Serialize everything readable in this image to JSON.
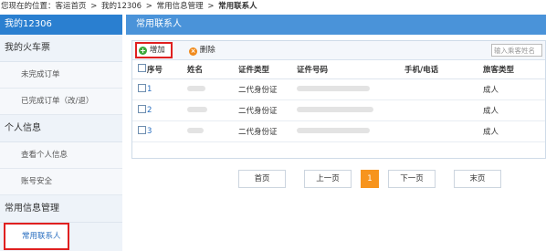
{
  "breadcrumb": {
    "prefix": "您现在的位置：客运首页",
    "sep": ">",
    "item1": "我的12306",
    "item2": "常用信息管理",
    "current": "常用联系人"
  },
  "sidebar": {
    "title": "我的12306",
    "sections": [
      {
        "label": "我的火车票",
        "items": [
          "未完成订单",
          "已完成订单（改/退）"
        ]
      },
      {
        "label": "个人信息",
        "items": [
          "查看个人信息",
          "账号安全"
        ]
      },
      {
        "label": "常用信息管理",
        "items": [
          "常用联系人"
        ]
      }
    ]
  },
  "main": {
    "title": "常用联系人",
    "toolbar": {
      "add_label": "增加",
      "delete_label": "删除",
      "search_placeholder": "输入乘客姓名"
    },
    "table": {
      "headers": [
        "序号",
        "姓名",
        "证件类型",
        "证件号码",
        "手机/电话",
        "旅客类型"
      ],
      "rows": [
        {
          "index": "1",
          "id_type": "二代身份证",
          "passenger_type": "成人"
        },
        {
          "index": "2",
          "id_type": "二代身份证",
          "passenger_type": "成人"
        },
        {
          "index": "3",
          "id_type": "二代身份证",
          "passenger_type": "成人"
        }
      ]
    },
    "pager": {
      "first": "首页",
      "prev": "上一页",
      "current": "1",
      "next": "下一页",
      "last": "末页"
    }
  },
  "colors": {
    "header_blue": "#2a7fd0",
    "highlight_red": "#e02020",
    "pager_active": "#f7941d"
  }
}
